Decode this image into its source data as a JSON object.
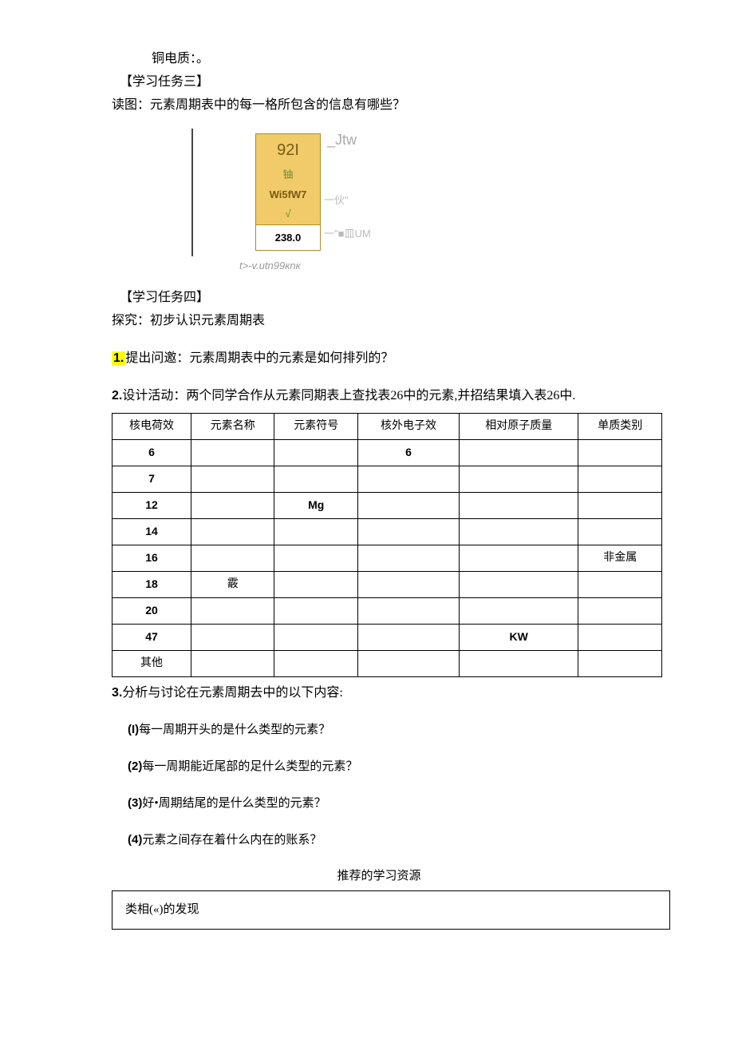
{
  "top_line": "铜电质：。",
  "task3_label": "【学习任务三】",
  "task3_text": "读图：元素周期表中的每一格所包含的信息有哪些？",
  "cell": {
    "number": "92I",
    "name": "铀",
    "sym_row": "Wi5fW7",
    "check": "√",
    "mass": "238.0",
    "label_jtw": "_Jtw",
    "label_huo": "一伙\"",
    "label_box": "一\"■皿UM",
    "caption": "t>-v.utn99кnк"
  },
  "task4_label": "【学习任务四】",
  "task4_text": "探究：初步认识元素周期表",
  "q1_prefix": "1.",
  "q1_text": "提出问邀：元素周期表中的元素是如何排列的？",
  "q2_prefix": "2.",
  "q2_text": "设计活动：两个同学合作从元素同期表上查找表26中的元素,并招结果填入表26中.",
  "headers": {
    "c0": "核电荷效",
    "c1": "元素名称",
    "c2": "元素符号",
    "c3": "核外电子效",
    "c4": "相对原子质量",
    "c5": "单质类别"
  },
  "rows": [
    {
      "c0": "6",
      "c1": "",
      "c2": "",
      "c3": "6",
      "c4": "",
      "c5": ""
    },
    {
      "c0": "7",
      "c1": "",
      "c2": "",
      "c3": "",
      "c4": "",
      "c5": ""
    },
    {
      "c0": "12",
      "c1": "",
      "c2": "Mg",
      "c3": "",
      "c4": "",
      "c5": ""
    },
    {
      "c0": "14",
      "c1": "",
      "c2": "",
      "c3": "",
      "c4": "",
      "c5": ""
    },
    {
      "c0": "16",
      "c1": "",
      "c2": "",
      "c3": "",
      "c4": "",
      "c5": "非金属"
    },
    {
      "c0": "18",
      "c1": "霰",
      "c2": "",
      "c3": "",
      "c4": "",
      "c5": ""
    },
    {
      "c0": "20",
      "c1": "",
      "c2": "",
      "c3": "",
      "c4": "",
      "c5": ""
    },
    {
      "c0": "47",
      "c1": "",
      "c2": "",
      "c3": "",
      "c4": "KW",
      "c5": ""
    },
    {
      "c0": "其他",
      "c1": "",
      "c2": "",
      "c3": "",
      "c4": "",
      "c5": ""
    }
  ],
  "q3_prefix": "3.",
  "q3_text": "分析与讨论在元素周期去中的以下内容:",
  "sub": {
    "i": {
      "n": "(I)",
      "t": "每一周期开头的是什么类型的元素？"
    },
    "ii": {
      "n": "(2)",
      "t": "每一周期能近尾部的足什么类型的元素？"
    },
    "iii": {
      "n": "(3)",
      "t": "好•周期结尾的是什么类型的元素？"
    },
    "iv": {
      "n": "(4)",
      "t": "元素之间存在着什么内在的账系？"
    }
  },
  "resource_title": "推荐的学习资源",
  "resource_cell": "类相(«)的发现"
}
